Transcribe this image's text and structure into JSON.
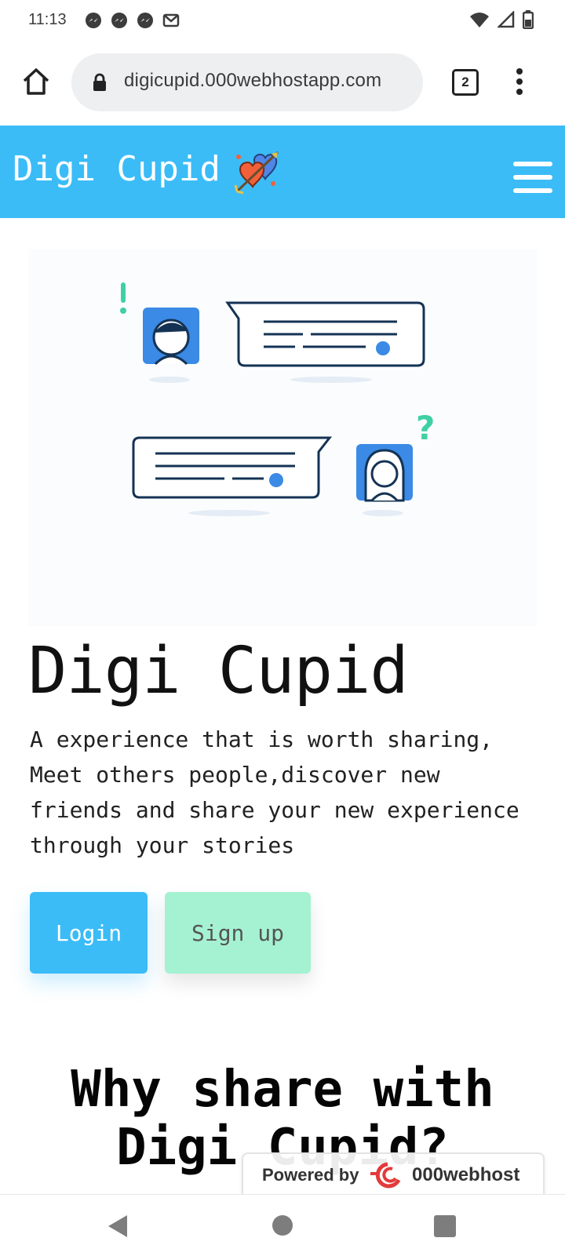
{
  "status_bar": {
    "time": "11:13",
    "left_icons": [
      "messenger-icon",
      "messenger-icon",
      "messenger-icon",
      "gmail-icon"
    ],
    "right_icons": [
      "wifi-icon",
      "signal-icon",
      "battery-icon"
    ]
  },
  "browser": {
    "url": "digicupid.000webhostapp.com",
    "tab_count": "2"
  },
  "navbar": {
    "brand": "Digi Cupid",
    "background_color": "#3bbcf7"
  },
  "hero": {
    "title": "Digi Cupid",
    "description": "A experience that is worth sharing, Meet others people,discover new friends and share your new experience through your stories",
    "login_label": "Login",
    "signup_label": "Sign up",
    "login_color": "#3bbcf7",
    "signup_color": "#a5f2d3"
  },
  "why_section": {
    "title": "Why share with Digi Cupid?"
  },
  "powered_badge": {
    "label": "Powered by",
    "brand": "000webhost"
  }
}
